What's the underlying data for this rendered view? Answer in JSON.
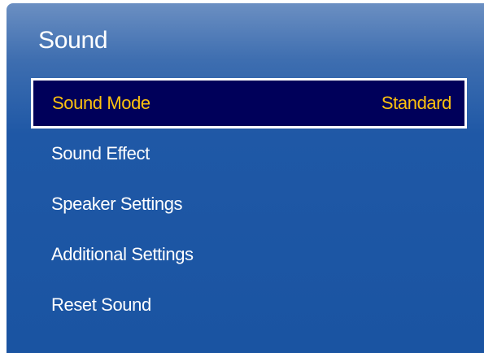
{
  "menu": {
    "title": "Sound",
    "items": [
      {
        "label": "Sound Mode",
        "value": "Standard",
        "selected": true
      },
      {
        "label": "Sound Effect"
      },
      {
        "label": "Speaker Settings"
      },
      {
        "label": "Additional Settings"
      },
      {
        "label": "Reset Sound"
      }
    ]
  },
  "colors": {
    "panel_background": "#1f58a6",
    "panel_top": "#6b8fc2",
    "selected_background": "#00005a",
    "selected_text": "#ffc20e",
    "text": "#ffffff",
    "selected_border": "#ffffff"
  }
}
